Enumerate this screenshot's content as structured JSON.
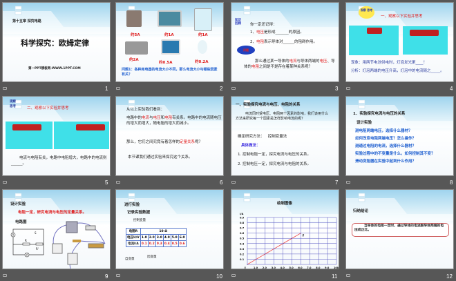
{
  "slides": [
    {
      "number": "1",
      "chapter": "第十五章 探究电路",
      "title": "科学探究：欧姆定律",
      "site": "第一PPT模板网-WWW.1PPT.COM"
    },
    {
      "number": "2",
      "labels": [
        "约5A",
        "约1A",
        "约1A",
        "约2A",
        "约0.5A",
        "约0.2A"
      ],
      "question": "问题1：各种用电器的电流大小不同，那么电流大小与哪些因素有关？"
    },
    {
      "number": "3",
      "tag": "知识 回顾",
      "intro": "你一定还记得：",
      "item1_pre": "1、",
      "item1_red": "电压",
      "item1_post": "是形成_______的原因。",
      "item2_pre": "2、",
      "item2_red": "电阻",
      "item2_post": "表示导体对______的阻碍作用。",
      "cloud": "问题",
      "q_pre": "那么通过某一导体的",
      "q_r1": "电流",
      "q_m1": "与导体两端的",
      "q_r2": "电压",
      "q_m2": "、导体的",
      "q_r3": "电阻",
      "q_post": "之间是不是存在着某种关系呢？"
    },
    {
      "number": "4",
      "cloud": "观察 思考",
      "heading": "一、观察以下实验并思考",
      "phenomenon": "现象：用两节电池供电时，灯泡发光更____！",
      "analysis": "分析：灯泡两端的电压升高，灯泡中的电流随之_____。"
    },
    {
      "number": "5",
      "cloud": "观察 思考",
      "heading": "二、观察以下实验并思考",
      "text": "电流与电阻有关，电路中电阻增大，电路中的电流则______。"
    },
    {
      "number": "6",
      "intro": "从以上实验我们看到：",
      "p1_pre": "电路中的",
      "p1_r1": "电流",
      "p1_m1": "与",
      "p1_r2": "电压",
      "p1_m2": "和",
      "p1_r3": "电阻",
      "p1_post": "有关系。电路中的电流随电压的增大而增大，随电阻的增大而减小。",
      "p2_pre": "那么，它们之间究竟有着怎样的",
      "p2_red": "定量关系",
      "p2_post": "呢？",
      "p3": "本节课我们通过实验来探究这个关系。"
    },
    {
      "number": "7",
      "heading": "一、实验探究电流与电压、电阻的关系",
      "p1": "电流同时受电压、电阻两个因素的影响，我们该用什么方法来研究每一个因素是怎样影响电流的呢？",
      "method_label": "确定研究方法：",
      "method": "控制变量法",
      "concrete": "具体做法：",
      "s1": "1. 控制电阻一定，探究电流与电压的关系。",
      "s2": "2. 控制电压一定，探究电流与电阻的关系。"
    },
    {
      "number": "8",
      "heading": "1．实验探究电流与电压的关系",
      "design": "设计实验",
      "qs": [
        "测电阻两端电压，选择什么器材？",
        "如何改变电阻两端电压？怎么操作？",
        "测通过电阻的电流，选择什么器材？",
        "实验过程中的不变量是什么，如何控制其不变？",
        "滑动变阻器在实验中起到什么作用？"
      ]
    },
    {
      "number": "9",
      "heading": "设计实验",
      "goal": "电阻一定，研究电流与电压的定量关系。",
      "diagram_label": "电路图",
      "sym": [
        "A",
        "V",
        "S",
        "R",
        "R'"
      ]
    },
    {
      "number": "10",
      "heading": "进行实验",
      "record": "记录实验数据",
      "control": "控制变量",
      "table": {
        "r_label": "电阻R",
        "r_value": "10 Ω",
        "u_label": "电压U/V",
        "u": [
          "1.0",
          "2.0",
          "3.0",
          "4.0",
          "5.0",
          "6.0"
        ],
        "i_label": "电流I/A",
        "i": [
          "0.1",
          "0.2",
          "0.3",
          "0.4",
          "0.5",
          "0.6"
        ]
      },
      "indep": "自变量",
      "dep": "因变量"
    },
    {
      "number": "11",
      "heading": "绘制图像"
    },
    {
      "number": "12",
      "heading": "归纳结论",
      "conclusion": "当导体的电阻一定时，通过导体的电流跟导体两端的电压成正比。"
    }
  ],
  "chart_data": {
    "type": "line",
    "title": "绘制图像",
    "xlabel": "U/V",
    "ylabel": "I/A",
    "origin_label": "O",
    "xlim": [
      0,
      10
    ],
    "ylim": [
      0,
      0.9
    ],
    "x_ticks": [
      "1.0",
      "2.0",
      "3.0",
      "4.0",
      "5.0",
      "6.0",
      "7.0",
      "8.0",
      "9.0",
      "10.0"
    ],
    "y_ticks": [
      "0.1",
      "0.2",
      "0.3",
      "0.4",
      "0.5",
      "0.6",
      "0.7",
      "0.8",
      "0.9"
    ],
    "series": [
      {
        "name": "R",
        "x": [
          0,
          1,
          2,
          3,
          4,
          5,
          6
        ],
        "y": [
          0,
          0.1,
          0.2,
          0.3,
          0.4,
          0.5,
          0.6
        ]
      }
    ],
    "grid": true,
    "color": "#ee4444"
  },
  "colors": {
    "accent_red": "#e01c1c",
    "accent_blue": "#2060d0",
    "background": "#575757"
  }
}
